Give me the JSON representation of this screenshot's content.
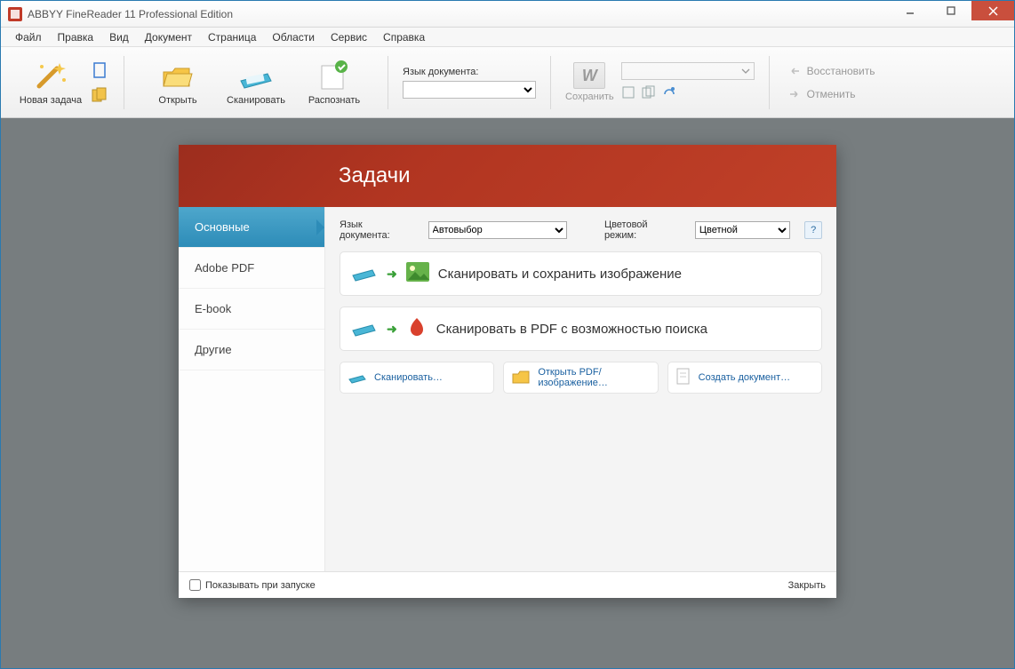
{
  "window": {
    "title": "ABBYY FineReader 11 Professional Edition"
  },
  "menu": {
    "file": "Файл",
    "edit": "Правка",
    "view": "Вид",
    "document": "Документ",
    "page": "Страница",
    "areas": "Области",
    "service": "Сервис",
    "help": "Справка"
  },
  "toolbar": {
    "new_task": "Новая задача",
    "open": "Открыть",
    "scan": "Сканировать",
    "recognize": "Распознать",
    "lang_label": "Язык документа:",
    "save": "Сохранить",
    "restore": "Восстановить",
    "cancel": "Отменить"
  },
  "dialog": {
    "title": "Задачи",
    "sidebar": {
      "main": "Основные",
      "pdf": "Adobe PDF",
      "ebook": "E-book",
      "other": "Другие"
    },
    "opts": {
      "lang_label": "Язык документа:",
      "lang_value": "Автовыбор",
      "color_label": "Цветовой режим:",
      "color_value": "Цветной",
      "help": "?"
    },
    "tasks": {
      "scan_image": "Сканировать и сохранить изображение",
      "scan_pdf": "Сканировать в PDF с возможностью поиска"
    },
    "small": {
      "scan": "Сканировать…",
      "open_pdf": "Открыть PDF/изображение…",
      "create": "Создать документ…"
    },
    "footer": {
      "show_startup": "Показывать при запуске",
      "close": "Закрыть"
    }
  }
}
